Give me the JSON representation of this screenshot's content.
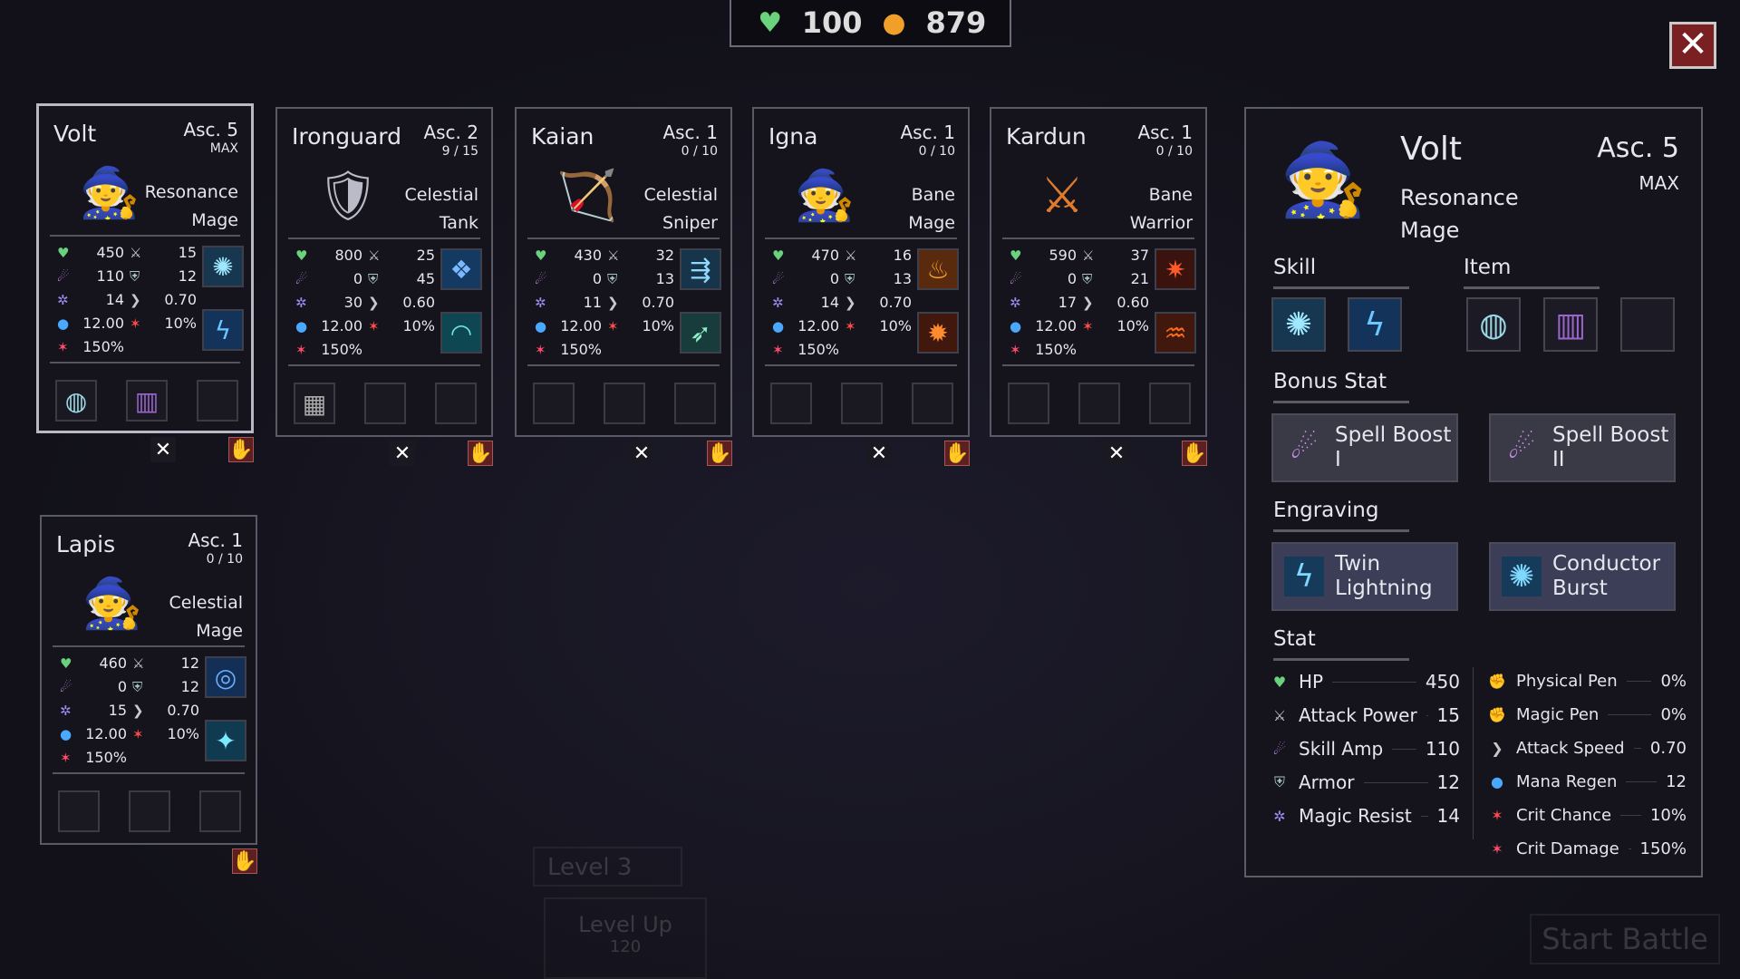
{
  "resources": {
    "hp": "100",
    "gold": "879"
  },
  "units": [
    {
      "name": "Volt",
      "asc": "Asc. 5",
      "cap": "MAX",
      "role1": "Resonance",
      "role2": "Mage",
      "hp": "450",
      "atk": "15",
      "amp": "110",
      "armor": "12",
      "mres": "14",
      "aspd": "0.70",
      "mana": "12.00",
      "crit": "10%",
      "cdmg": "150%"
    },
    {
      "name": "Ironguard",
      "asc": "Asc. 2",
      "cap": "9 / 15",
      "role1": "Celestial",
      "role2": "Tank",
      "hp": "800",
      "atk": "25",
      "amp": "0",
      "armor": "45",
      "mres": "30",
      "aspd": "0.60",
      "mana": "12.00",
      "crit": "10%",
      "cdmg": "150%"
    },
    {
      "name": "Kaian",
      "asc": "Asc. 1",
      "cap": "0 / 10",
      "role1": "Celestial",
      "role2": "Sniper",
      "hp": "430",
      "atk": "32",
      "amp": "0",
      "armor": "13",
      "mres": "11",
      "aspd": "0.70",
      "mana": "12.00",
      "crit": "10%",
      "cdmg": "150%"
    },
    {
      "name": "Igna",
      "asc": "Asc. 1",
      "cap": "0 / 10",
      "role1": "Bane",
      "role2": "Mage",
      "hp": "470",
      "atk": "16",
      "amp": "0",
      "armor": "13",
      "mres": "14",
      "aspd": "0.70",
      "mana": "12.00",
      "crit": "10%",
      "cdmg": "150%"
    },
    {
      "name": "Kardun",
      "asc": "Asc. 1",
      "cap": "0 / 10",
      "role1": "Bane",
      "role2": "Warrior",
      "hp": "590",
      "atk": "37",
      "amp": "0",
      "armor": "21",
      "mres": "17",
      "aspd": "0.60",
      "mana": "12.00",
      "crit": "10%",
      "cdmg": "150%"
    },
    {
      "name": "Lapis",
      "asc": "Asc. 1",
      "cap": "0 / 10",
      "role1": "Celestial",
      "role2": "Mage",
      "hp": "460",
      "atk": "12",
      "amp": "0",
      "armor": "12",
      "mres": "15",
      "aspd": "0.70",
      "mana": "12.00",
      "crit": "10%",
      "cdmg": "150%"
    }
  ],
  "detail": {
    "name": "Volt",
    "asc": "Asc. 5",
    "cap": "MAX",
    "role1": "Resonance",
    "role2": "Mage",
    "skill_title": "Skill",
    "item_title": "Item",
    "bonus_title": "Bonus Stat",
    "engraving_title": "Engraving",
    "stat_title": "Stat",
    "bonus": [
      {
        "l1": "Spell Boost",
        "l2": "I"
      },
      {
        "l1": "Spell Boost",
        "l2": "II"
      }
    ],
    "engraving": [
      {
        "l1": "Twin",
        "l2": "Lightning"
      },
      {
        "l1": "Conductor",
        "l2": "Burst"
      }
    ],
    "stats_left": [
      {
        "label": "HP",
        "value": "450"
      },
      {
        "label": "Attack Power",
        "value": "15"
      },
      {
        "label": "Skill Amp",
        "value": "110"
      },
      {
        "label": "Armor",
        "value": "12"
      },
      {
        "label": "Magic Resist",
        "value": "14"
      }
    ],
    "stats_right": [
      {
        "label": "Physical Pen",
        "value": "0%"
      },
      {
        "label": "Magic Pen",
        "value": "0%"
      },
      {
        "label": "Attack Speed",
        "value": "0.70"
      },
      {
        "label": "Mana Regen",
        "value": "12"
      },
      {
        "label": "Crit Chance",
        "value": "10%"
      },
      {
        "label": "Crit Damage",
        "value": "150%"
      }
    ]
  },
  "background": {
    "level": "Level 3",
    "level_up": "Level Up",
    "cost": "120",
    "start": "Start Battle"
  }
}
